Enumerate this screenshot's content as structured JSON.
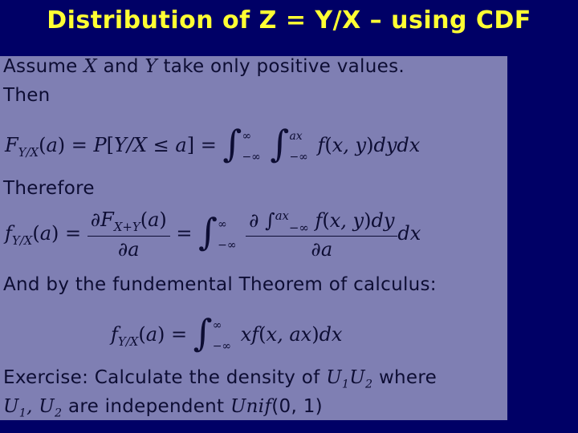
{
  "slide": {
    "title": "Distribution of Z = Y/X – using CDF",
    "colors": {
      "background": "#000066",
      "panel": "#7f7fb3",
      "title": "#ffff33",
      "text": "#0d0d33"
    },
    "lines": {
      "assume": "Assume X and Y take only positive values.",
      "then": "Then",
      "eq1": "F_{Y/X}(a) = P[Y/X ≤ a] = ∫_{-∞}^{∞} ∫_{-∞}^{ax} f(x,y) dy dx",
      "therefore": "Therefore",
      "eq2": "f_{Y/X}(a) = ∂F_{X+Y}(a)/∂a = ∫_{-∞}^{∞} (∂ ∫_{-∞}^{ax} f(x,y)dy)/∂a dx",
      "fundamental": "And by the fundemental Theorem of calculus:",
      "eq3": "f_{Y/X}(a) = ∫_{-∞}^{∞} x f(x,ax) dx",
      "exercise1": "Exercise: Calculate the density of U1U2 where",
      "exercise2": "U1, U2 are independent Unif(0,1)"
    },
    "parts": {
      "assume_a": "Assume",
      "X": "X",
      "and": "and",
      "Y": "Y",
      "assume_b": "take only positive values.",
      "ex_a": "Exercise: Calculate the density of",
      "U1U2": "U",
      "where": "where",
      "are_indep": "are independent",
      "unif": "Unif",
      "unif_args": "(0, 1)"
    }
  }
}
